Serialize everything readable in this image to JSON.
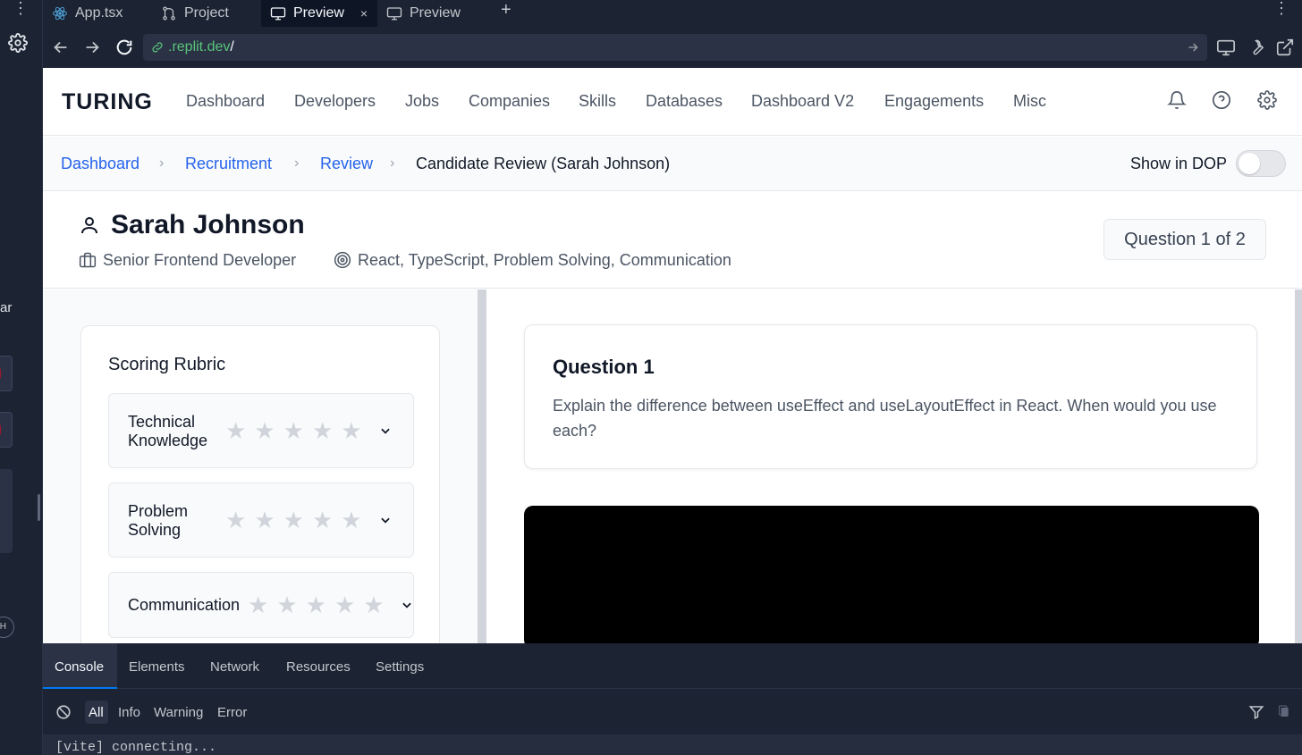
{
  "sidebar": {
    "partial_text": "ar",
    "avatar_text": "H"
  },
  "tabs": [
    {
      "label": "App.tsx",
      "icon": "react-icon"
    },
    {
      "label": "Project",
      "icon": "git-branch-icon"
    },
    {
      "label": "Preview",
      "icon": "monitor-icon",
      "active": true,
      "close": "×"
    },
    {
      "label": "Preview",
      "icon": "monitor-icon"
    }
  ],
  "tab_controls": {
    "add": "+",
    "more": "⋮"
  },
  "address": {
    "url": ".replit.dev",
    "suffix": "/"
  },
  "app": {
    "logo": "TURING",
    "nav": [
      "Dashboard",
      "Developers",
      "Jobs",
      "Companies",
      "Skills",
      "Databases",
      "Dashboard V2",
      "Engagements",
      "Misc"
    ],
    "breadcrumbs": [
      "Dashboard",
      "Recruitment",
      "Review"
    ],
    "breadcrumb_separator": "›",
    "breadcrumb_current": "Candidate Review (Sarah Johnson)",
    "show_in_dop": {
      "label": "Show in DOP",
      "enabled": false
    },
    "candidate": {
      "name": "Sarah Johnson",
      "role": "Senior Frontend Developer",
      "skills": "React, TypeScript, Problem Solving, Communication"
    },
    "question_counter": "Question 1 of 2",
    "rubric": {
      "title": "Scoring Rubric",
      "criteria": [
        {
          "label": "Technical Knowledge",
          "rating": 0,
          "max": 5
        },
        {
          "label": "Problem Solving",
          "rating": 0,
          "max": 5
        },
        {
          "label": "Communication",
          "rating": 0,
          "max": 5
        }
      ],
      "star_glyph": "★"
    },
    "question": {
      "title": "Question 1",
      "text": "Explain the difference between useEffect and useLayoutEffect in React. When would you use each?"
    }
  },
  "devtools": {
    "tabs": [
      "Console",
      "Elements",
      "Network",
      "Resources",
      "Settings"
    ],
    "levels": [
      "All",
      "Info",
      "Warning",
      "Error"
    ],
    "log": "[vite] connecting..."
  },
  "colors": {
    "accent": "#2563eb",
    "url_green": "#58c47a",
    "devtools_blue": "#0079f2"
  }
}
